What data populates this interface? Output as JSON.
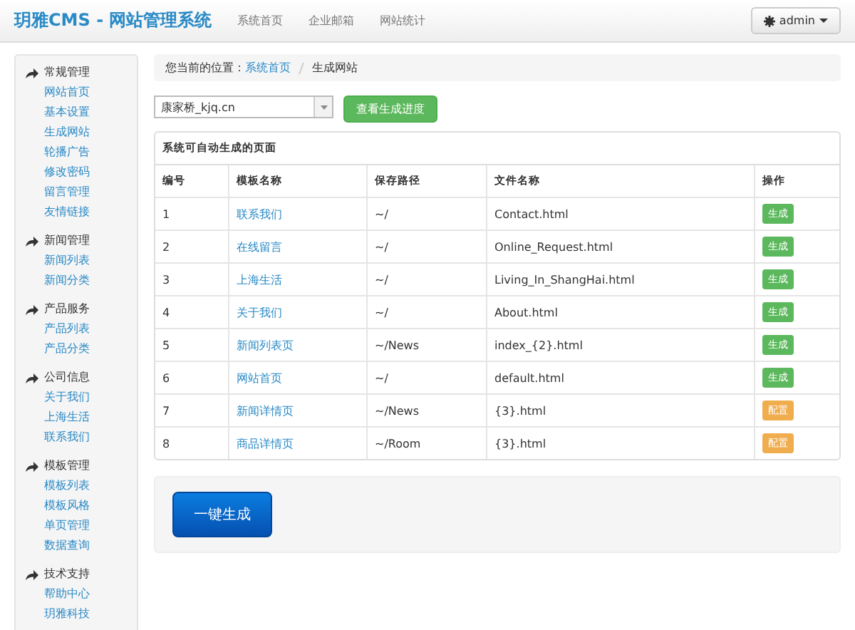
{
  "navbar": {
    "brand": "玥雅CMS - 网站管理系统",
    "links": [
      "系统首页",
      "企业邮箱",
      "网站统计"
    ],
    "user": "admin"
  },
  "sidebar": [
    {
      "title": "常规管理",
      "items": [
        "网站首页",
        "基本设置",
        "生成网站",
        "轮播广告",
        "修改密码",
        "留言管理",
        "友情链接"
      ]
    },
    {
      "title": "新闻管理",
      "items": [
        "新闻列表",
        "新闻分类"
      ]
    },
    {
      "title": "产品服务",
      "items": [
        "产品列表",
        "产品分类"
      ]
    },
    {
      "title": "公司信息",
      "items": [
        "关于我们",
        "上海生活",
        "联系我们"
      ]
    },
    {
      "title": "模板管理",
      "items": [
        "模板列表",
        "模板风格",
        "单页管理",
        "数据查询"
      ]
    },
    {
      "title": "技术支持",
      "items": [
        "帮助中心",
        "玥雅科技"
      ]
    }
  ],
  "breadcrumb": {
    "label": "您当前的位置：",
    "links": [
      "系统首页"
    ],
    "current": "生成网站"
  },
  "site_select": {
    "value": "康家桥_kjq.cn"
  },
  "progress_button": "查看生成进度",
  "table": {
    "caption": "系统可自动生成的页面",
    "columns": [
      "编号",
      "模板名称",
      "保存路径",
      "文件名称",
      "操作"
    ],
    "rows": [
      {
        "id": "1",
        "template": "联系我们",
        "path": "~/",
        "file": "Contact.html",
        "action": {
          "kind": "generate",
          "label": "生成"
        }
      },
      {
        "id": "2",
        "template": "在线留言",
        "path": "~/",
        "file": "Online_Request.html",
        "action": {
          "kind": "generate",
          "label": "生成"
        }
      },
      {
        "id": "3",
        "template": "上海生活",
        "path": "~/",
        "file": "Living_In_ShangHai.html",
        "action": {
          "kind": "generate",
          "label": "生成"
        }
      },
      {
        "id": "4",
        "template": "关于我们",
        "path": "~/",
        "file": "About.html",
        "action": {
          "kind": "generate",
          "label": "生成"
        }
      },
      {
        "id": "5",
        "template": "新闻列表页",
        "path": "~/News",
        "file": "index_{2}.html",
        "action": {
          "kind": "generate",
          "label": "生成"
        }
      },
      {
        "id": "6",
        "template": "网站首页",
        "path": "~/",
        "file": "default.html",
        "action": {
          "kind": "generate",
          "label": "生成"
        }
      },
      {
        "id": "7",
        "template": "新闻详情页",
        "path": "~/News",
        "file": "{3}.html",
        "action": {
          "kind": "configure",
          "label": "配置"
        }
      },
      {
        "id": "8",
        "template": "商品详情页",
        "path": "~/Room",
        "file": "{3}.html",
        "action": {
          "kind": "configure",
          "label": "配置"
        }
      }
    ]
  },
  "generate_all_button": "一键生成"
}
